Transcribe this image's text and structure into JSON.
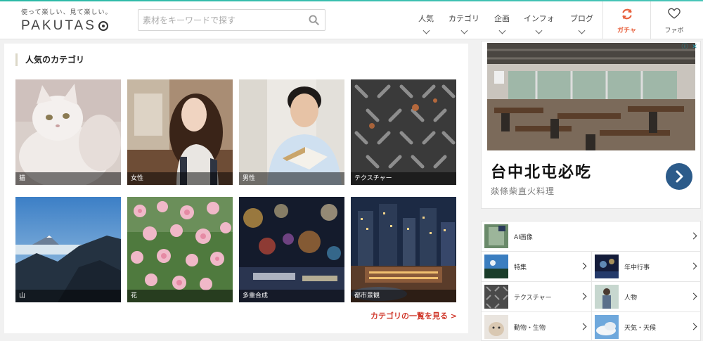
{
  "header": {
    "tagline": "使って楽しい、見て楽しい。",
    "logo_text": "PAKUTAS",
    "search_placeholder": "素材をキーワードで探す",
    "nav": [
      {
        "label": "人気"
      },
      {
        "label": "カテゴリ"
      },
      {
        "label": "企画"
      },
      {
        "label": "インフォ"
      },
      {
        "label": "ブログ"
      }
    ],
    "gacha_label": "ガチャ",
    "favorite_label": "ファボ"
  },
  "popular": {
    "title": "人気のカテゴリ",
    "tiles": [
      {
        "label": "猫"
      },
      {
        "label": "女性"
      },
      {
        "label": "男性"
      },
      {
        "label": "テクスチャー"
      },
      {
        "label": "山"
      },
      {
        "label": "花"
      },
      {
        "label": "多重合成"
      },
      {
        "label": "都市景観"
      }
    ],
    "more_link": "カテゴリの一覧を見る >"
  },
  "ad": {
    "title": "台中北屯必吃",
    "subtitle": "燚條柴直火料理"
  },
  "category_list": {
    "items": [
      {
        "label": "AI画像"
      },
      {
        "label": "特集"
      },
      {
        "label": "年中行事"
      },
      {
        "label": "テクスチャー"
      },
      {
        "label": "人物"
      },
      {
        "label": "動物・生物"
      },
      {
        "label": "天気・天候"
      }
    ]
  },
  "colors": {
    "accent_red": "#d0382b",
    "gacha_orange": "#e8603c",
    "brand_teal": "#2bb9a6"
  }
}
